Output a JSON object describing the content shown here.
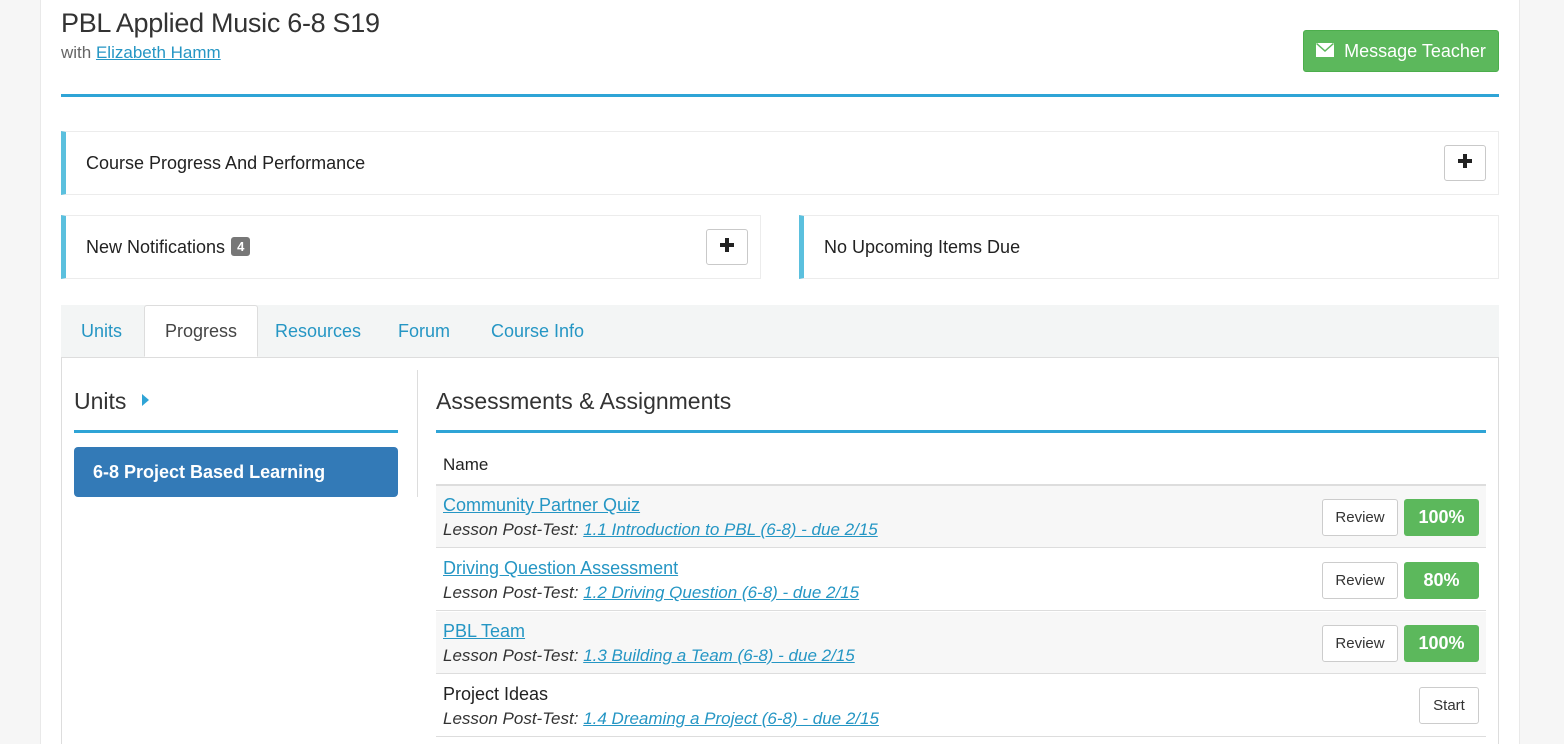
{
  "course": {
    "title": "PBL Applied Music 6-8 S19",
    "with_prefix": "with",
    "teacher_name": "Elizabeth Hamm",
    "message_button": "Message Teacher"
  },
  "panels": {
    "progress_label": "Course Progress And Performance",
    "notifications_label": "New Notifications",
    "notifications_count": "4",
    "upcoming_label": "No Upcoming Items Due"
  },
  "tabs": [
    {
      "label": "Units"
    },
    {
      "label": "Progress"
    },
    {
      "label": "Resources"
    },
    {
      "label": "Forum"
    },
    {
      "label": "Course Info"
    }
  ],
  "active_tab": "Progress",
  "units": {
    "title": "Units",
    "items": [
      {
        "label": "6-8 Project Based Learning"
      }
    ]
  },
  "assessments": {
    "title": "Assessments & Assignments",
    "column_name": "Name",
    "rows": [
      {
        "name": "Community Partner Quiz",
        "type": "Lesson Post-Test:",
        "lesson": "1.1 Introduction to PBL (6-8) - due 2/15",
        "action": "Review",
        "score": "100%"
      },
      {
        "name": "Driving Question Assessment",
        "type": "Lesson Post-Test:",
        "lesson": "1.2 Driving Question (6-8) - due 2/15",
        "action": "Review",
        "score": "80%"
      },
      {
        "name": "PBL Team",
        "type": "Lesson Post-Test:",
        "lesson": "1.3 Building a Team (6-8) - due 2/15",
        "action": "Review",
        "score": "100%"
      },
      {
        "name": "Project Ideas",
        "type": "Lesson Post-Test:",
        "lesson": "1.4 Dreaming a Project (6-8) - due 2/15",
        "action": "Start"
      }
    ]
  },
  "colors": {
    "accent": "#2fa4d6",
    "success": "#5cb85c",
    "primary": "#337ab7",
    "panel_border": "#5bc0de"
  }
}
